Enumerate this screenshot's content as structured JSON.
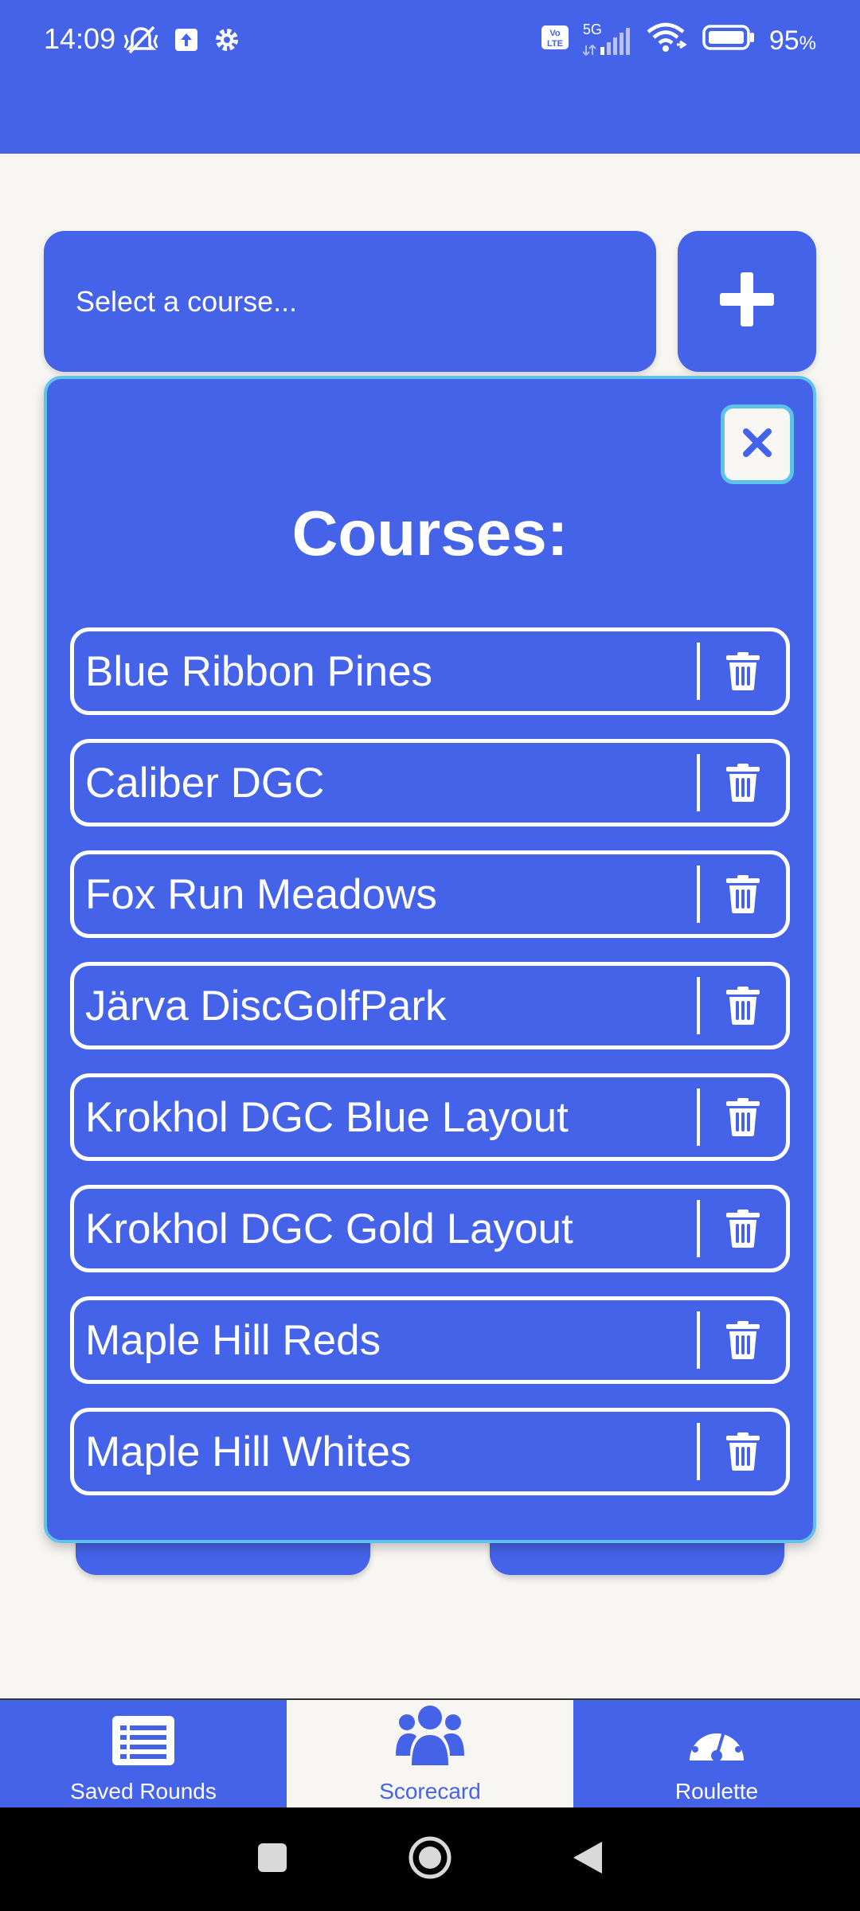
{
  "status_bar": {
    "time": "14:09",
    "network": "5G",
    "battery": "95",
    "battery_unit": "%",
    "left_icons": [
      "mute-vibrate-icon",
      "upload-icon",
      "settings-gear-icon"
    ],
    "right_icons": [
      "volte-icon",
      "signal-icon",
      "wifi-icon",
      "battery-icon"
    ]
  },
  "course_select": {
    "placeholder": "Select a course...",
    "add_icon": "plus-icon"
  },
  "modal": {
    "title": "Courses:",
    "close_icon": "close-x-icon",
    "delete_icon": "trash-icon",
    "courses": [
      "Blue Ribbon Pines",
      "Caliber DGC",
      "Fox Run Meadows",
      "Järva DiscGolfPark",
      "Krokhol DGC Blue Layout",
      "Krokhol DGC Gold Layout",
      "Maple Hill Reds",
      "Maple Hill Whites"
    ]
  },
  "bottom_nav": {
    "items": [
      {
        "label": "Saved Rounds",
        "icon": "list-icon",
        "active": false
      },
      {
        "label": "Scorecard",
        "icon": "users-icon",
        "active": true
      },
      {
        "label": "Roulette",
        "icon": "gauge-icon",
        "active": false
      }
    ]
  },
  "system_nav": [
    "recents-square-icon",
    "home-circle-icon",
    "back-triangle-icon"
  ],
  "colors": {
    "primary": "#4563e8",
    "accent_border": "#5ec3ea",
    "background": "#f8f6f3"
  }
}
